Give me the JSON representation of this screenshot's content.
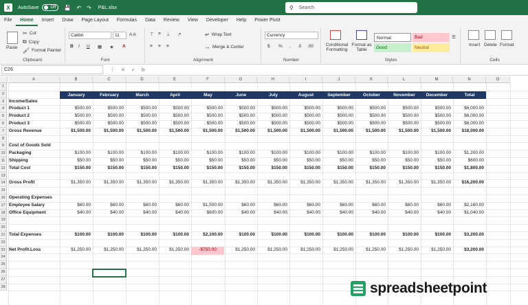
{
  "titlebar": {
    "logo": "X",
    "autosave": "AutoSave",
    "toggle": "Off",
    "filename": "P&L.xlsx",
    "search": "Search"
  },
  "tabs": [
    "File",
    "Home",
    "Insert",
    "Draw",
    "Page Layout",
    "Formulas",
    "Data",
    "Review",
    "View",
    "Developer",
    "Help",
    "Power Pivot"
  ],
  "ribbon": {
    "clipboard": {
      "paste": "Paste",
      "cut": "Cut",
      "copy": "Copy",
      "painter": "Format Painter",
      "label": "Clipboard"
    },
    "font": {
      "name": "Calibri",
      "size": "11",
      "label": "Font"
    },
    "alignment": {
      "wrap": "Wrap Text",
      "merge": "Merge & Center",
      "label": "Alignment"
    },
    "number": {
      "format": "Currency",
      "label": "Number"
    },
    "styles": {
      "cond": "Conditional Formatting",
      "table": "Format as Table",
      "normal": "Normal",
      "bad": "Bad",
      "good": "Good",
      "neutral": "Neutral",
      "label": "Styles"
    },
    "cells": {
      "insert": "Insert",
      "delete": "Delete",
      "format": "Format",
      "label": "Cells"
    }
  },
  "formula": {
    "namebox": "C26",
    "fx": "fx"
  },
  "columns": [
    "A",
    "B",
    "C",
    "D",
    "E",
    "F",
    "G",
    "H",
    "I",
    "J",
    "K",
    "L",
    "M",
    "N",
    "O"
  ],
  "months": [
    "January",
    "February",
    "March",
    "April",
    "May",
    "June",
    "July",
    "August",
    "September",
    "October",
    "November",
    "December",
    "Total"
  ],
  "rows": [
    {
      "r": "1"
    },
    {
      "r": "2"
    },
    {
      "r": "3",
      "a": "Income/Sales"
    },
    {
      "r": "4",
      "a": "Product 1",
      "v": [
        "$500.00",
        "$500.00",
        "$500.00",
        "$500.00",
        "$500.00",
        "$500.00",
        "$500.00",
        "$500.00",
        "$500.00",
        "$500.00",
        "$500.00",
        "$500.00",
        "$6,000.00"
      ]
    },
    {
      "r": "5",
      "a": "Product 2",
      "v": [
        "$500.00",
        "$500.00",
        "$500.00",
        "$500.00",
        "$500.00",
        "$500.00",
        "$500.00",
        "$500.00",
        "$500.00",
        "$500.00",
        "$500.00",
        "$500.00",
        "$6,000.00"
      ]
    },
    {
      "r": "6",
      "a": "Product 3",
      "v": [
        "$500.00",
        "$500.00",
        "$500.00",
        "$500.00",
        "$500.00",
        "$500.00",
        "$500.00",
        "$500.00",
        "$500.00",
        "$500.00",
        "$500.00",
        "$500.00",
        "$6,000.00"
      ]
    },
    {
      "r": "7",
      "a": "Gross Revenue",
      "b": true,
      "v": [
        "$1,500.00",
        "$1,500.00",
        "$1,500.00",
        "$1,500.00",
        "$1,500.00",
        "$1,500.00",
        "$1,500.00",
        "$1,500.00",
        "$1,500.00",
        "$1,500.00",
        "$1,500.00",
        "$1,500.00",
        "$18,000.00"
      ]
    },
    {
      "r": "8"
    },
    {
      "r": "9",
      "a": "Cost of Goods Sold"
    },
    {
      "r": "10",
      "a": "Packaging",
      "v": [
        "$100.00",
        "$100.00",
        "$100.00",
        "$100.00",
        "$100.00",
        "$100.00",
        "$100.00",
        "$100.00",
        "$100.00",
        "$100.00",
        "$100.00",
        "$100.00",
        "$1,200.00"
      ]
    },
    {
      "r": "11",
      "a": "Shipping",
      "v": [
        "$50.00",
        "$50.00",
        "$50.00",
        "$50.00",
        "$50.00",
        "$50.00",
        "$50.00",
        "$50.00",
        "$50.00",
        "$50.00",
        "$50.00",
        "$50.00",
        "$600.00"
      ]
    },
    {
      "r": "12",
      "a": "Total Cost",
      "b": true,
      "v": [
        "$150.00",
        "$150.00",
        "$150.00",
        "$150.00",
        "$150.00",
        "$150.00",
        "$150.00",
        "$150.00",
        "$150.00",
        "$150.00",
        "$150.00",
        "$150.00",
        "$1,800.00"
      ]
    },
    {
      "r": "13"
    },
    {
      "r": "14",
      "a": "Gross Profit",
      "v": [
        "$1,350.00",
        "$1,350.00",
        "$1,350.00",
        "$1,350.00",
        "$1,350.00",
        "$1,350.00",
        "$1,350.00",
        "$1,350.00",
        "$1,350.00",
        "$1,350.00",
        "$1,350.00",
        "$1,350.00",
        "$16,200.00"
      ],
      "tb": true
    },
    {
      "r": "15"
    },
    {
      "r": "16",
      "a": "Operating Expenses"
    },
    {
      "r": "17",
      "a": "Employee Salary",
      "v": [
        "$60.00",
        "$60.00",
        "$60.00",
        "$60.00",
        "$1,500.00",
        "$60.00",
        "$60.00",
        "$60.00",
        "$60.00",
        "$60.00",
        "$60.00",
        "$60.00",
        "$2,160.00"
      ]
    },
    {
      "r": "18",
      "a": "Office Equipment",
      "v": [
        "$40.00",
        "$40.00",
        "$40.00",
        "$40.00",
        "$600.00",
        "$40.00",
        "$40.00",
        "$40.00",
        "$40.00",
        "$40.00",
        "$40.00",
        "$40.00",
        "$1,040.00"
      ]
    },
    {
      "r": "19"
    },
    {
      "r": "20"
    },
    {
      "r": "21",
      "a": "Total Expenses",
      "b": true,
      "v": [
        "$100.00",
        "$100.00",
        "$100.00",
        "$100.00",
        "$2,100.00",
        "$100.00",
        "$100.00",
        "$100.00",
        "$100.00",
        "$100.00",
        "$100.00",
        "$100.00",
        "$3,200.00"
      ]
    },
    {
      "r": "22"
    },
    {
      "r": "23",
      "a": "Net Profit.Loss",
      "v": [
        "$1,250.00",
        "$1,250.00",
        "$1,250.00",
        "$1,250.00",
        "-$750.00",
        "$1,250.00",
        "$1,250.00",
        "$1,250.00",
        "$1,250.00",
        "$1,250.00",
        "$1,250.00",
        "$1,250.00",
        "$3,200.00"
      ],
      "tb": true,
      "negcol": 4
    },
    {
      "r": "24"
    },
    {
      "r": "25"
    },
    {
      "r": "26"
    },
    {
      "r": "27"
    },
    {
      "r": "28"
    }
  ],
  "watermark": "spreadsheetpoint",
  "colors": {
    "brand": "#217346",
    "header_fill": "#1f3864",
    "negative_fill": "#ffc7ce"
  }
}
